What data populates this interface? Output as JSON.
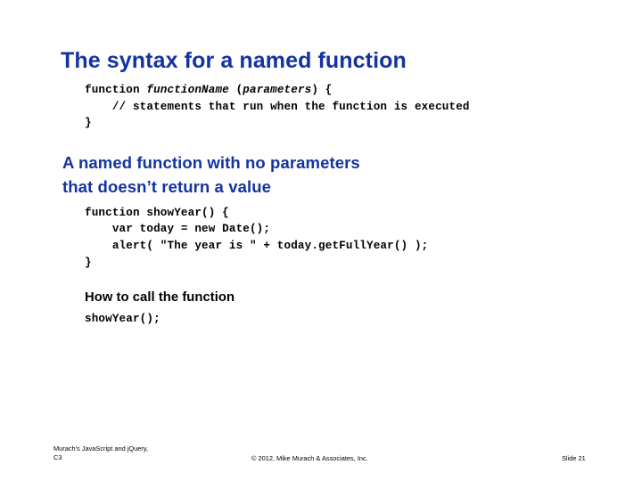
{
  "slide": {
    "title": "The syntax for a named function",
    "syntax_code": {
      "line1_kw": "function ",
      "line1_name": "functionName",
      "line1_open_paren": " (",
      "line1_params": "parameters",
      "line1_close": ") {",
      "line2": "    // statements that run when the function is executed",
      "line3": "}"
    },
    "sub_heading": "A named function with no parameters\nthat doesn’t return a value",
    "example_code": "function showYear() {\n    var today = new Date();\n    alert( \"The year is \" + today.getFullYear() );\n}",
    "howto_heading": "How to call the function",
    "howto_code": "showYear();",
    "colors": {
      "heading_blue": "#1433a0",
      "text_black": "#000000",
      "background": "#ffffff"
    }
  },
  "footer": {
    "left": "Murach's JavaScript and jQuery,\nC3",
    "center": "© 2012, Mike Murach & Associates, Inc.",
    "right": "Slide 21"
  }
}
